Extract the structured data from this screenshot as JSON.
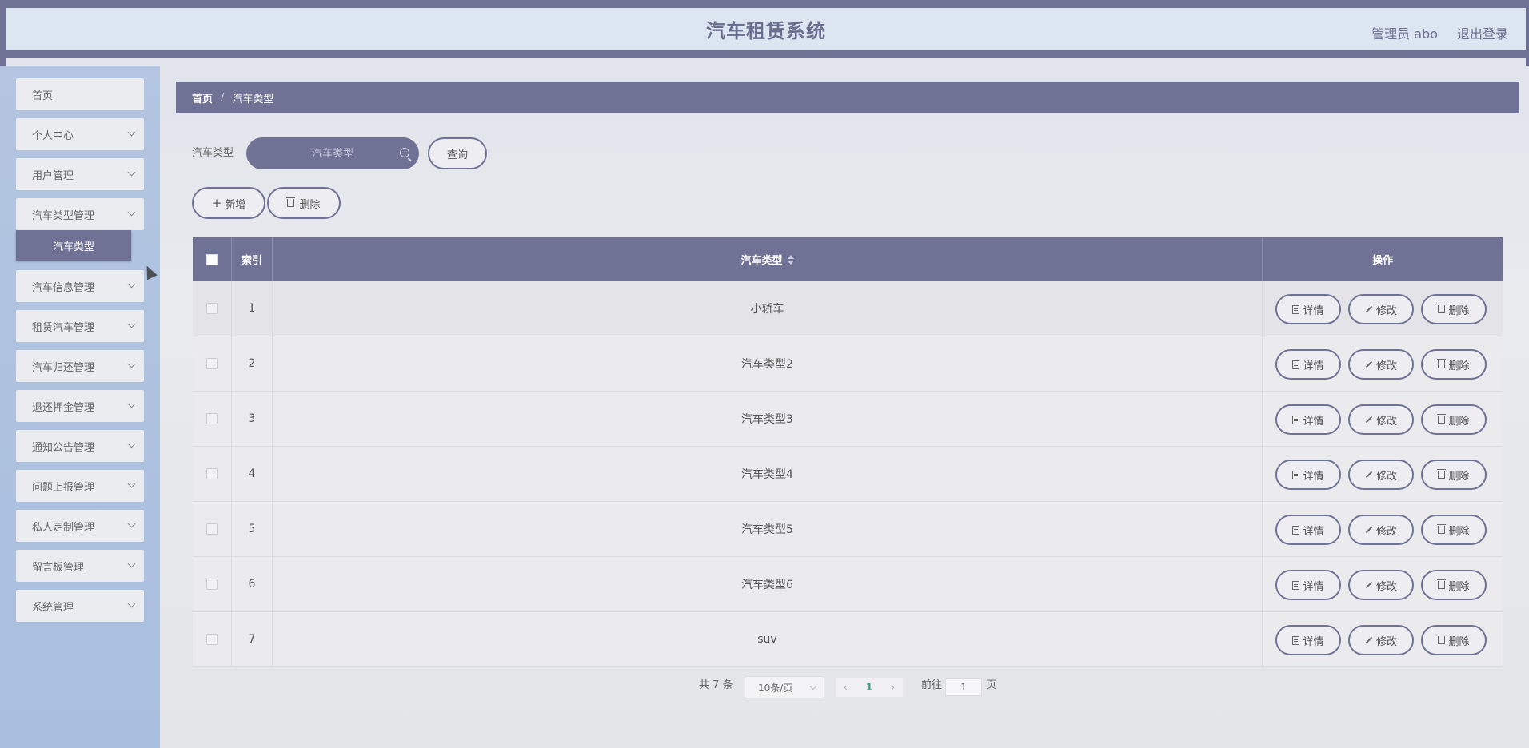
{
  "header": {
    "title": "汽车租赁系统",
    "user_label": "管理员 abo",
    "logout_label": "退出登录"
  },
  "sidebar": {
    "items": [
      {
        "label": "首页",
        "has_chevron": false
      },
      {
        "label": "个人中心",
        "has_chevron": true
      },
      {
        "label": "用户管理",
        "has_chevron": true
      },
      {
        "label": "汽车类型管理",
        "has_chevron": true
      },
      {
        "label": "汽车信息管理",
        "has_chevron": true
      },
      {
        "label": "租赁汽车管理",
        "has_chevron": true
      },
      {
        "label": "汽车归还管理",
        "has_chevron": true
      },
      {
        "label": "退还押金管理",
        "has_chevron": true
      },
      {
        "label": "通知公告管理",
        "has_chevron": true
      },
      {
        "label": "问题上报管理",
        "has_chevron": true
      },
      {
        "label": "私人定制管理",
        "has_chevron": true
      },
      {
        "label": "留言板管理",
        "has_chevron": true
      },
      {
        "label": "系统管理",
        "has_chevron": true
      }
    ],
    "active_submenu": "汽车类型"
  },
  "breadcrumb": {
    "home": "首页",
    "separator": "/",
    "current": "汽车类型"
  },
  "search": {
    "label": "汽车类型",
    "placeholder": "汽车类型",
    "value": "",
    "query_button": "查询"
  },
  "actions": {
    "add_label": "新增",
    "delete_label": "删除"
  },
  "table": {
    "columns": {
      "index": "索引",
      "type": "汽车类型",
      "ops": "操作"
    },
    "rows": [
      {
        "index": "1",
        "type": "小轿车"
      },
      {
        "index": "2",
        "type": "汽车类型2"
      },
      {
        "index": "3",
        "type": "汽车类型3"
      },
      {
        "index": "4",
        "type": "汽车类型4"
      },
      {
        "index": "5",
        "type": "汽车类型5"
      },
      {
        "index": "6",
        "type": "汽车类型6"
      },
      {
        "index": "7",
        "type": "suv"
      }
    ],
    "row_buttons": {
      "detail": "详情",
      "edit": "修改",
      "delete": "删除"
    }
  },
  "pagination": {
    "total": "共 7 条",
    "page_size": "10条/页",
    "current_page": "1",
    "goto_label": "前往",
    "goto_value": "1",
    "page_suffix": "页"
  },
  "colors": {
    "accent": "#6f7294",
    "header_bg": "#dbe6f1",
    "sidebar_bg": "#adc1df",
    "page_active": "#3a9a7d"
  }
}
